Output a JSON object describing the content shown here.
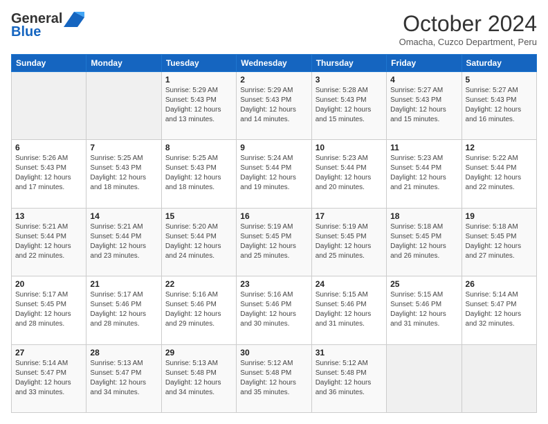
{
  "logo": {
    "line1": "General",
    "line2": "Blue"
  },
  "header": {
    "title": "October 2024",
    "subtitle": "Omacha, Cuzco Department, Peru"
  },
  "days_of_week": [
    "Sunday",
    "Monday",
    "Tuesday",
    "Wednesday",
    "Thursday",
    "Friday",
    "Saturday"
  ],
  "weeks": [
    [
      {
        "day": "",
        "sunrise": "",
        "sunset": "",
        "daylight": ""
      },
      {
        "day": "",
        "sunrise": "",
        "sunset": "",
        "daylight": ""
      },
      {
        "day": "1",
        "sunrise": "Sunrise: 5:29 AM",
        "sunset": "Sunset: 5:43 PM",
        "daylight": "Daylight: 12 hours and 13 minutes."
      },
      {
        "day": "2",
        "sunrise": "Sunrise: 5:29 AM",
        "sunset": "Sunset: 5:43 PM",
        "daylight": "Daylight: 12 hours and 14 minutes."
      },
      {
        "day": "3",
        "sunrise": "Sunrise: 5:28 AM",
        "sunset": "Sunset: 5:43 PM",
        "daylight": "Daylight: 12 hours and 15 minutes."
      },
      {
        "day": "4",
        "sunrise": "Sunrise: 5:27 AM",
        "sunset": "Sunset: 5:43 PM",
        "daylight": "Daylight: 12 hours and 15 minutes."
      },
      {
        "day": "5",
        "sunrise": "Sunrise: 5:27 AM",
        "sunset": "Sunset: 5:43 PM",
        "daylight": "Daylight: 12 hours and 16 minutes."
      }
    ],
    [
      {
        "day": "6",
        "sunrise": "Sunrise: 5:26 AM",
        "sunset": "Sunset: 5:43 PM",
        "daylight": "Daylight: 12 hours and 17 minutes."
      },
      {
        "day": "7",
        "sunrise": "Sunrise: 5:25 AM",
        "sunset": "Sunset: 5:43 PM",
        "daylight": "Daylight: 12 hours and 18 minutes."
      },
      {
        "day": "8",
        "sunrise": "Sunrise: 5:25 AM",
        "sunset": "Sunset: 5:43 PM",
        "daylight": "Daylight: 12 hours and 18 minutes."
      },
      {
        "day": "9",
        "sunrise": "Sunrise: 5:24 AM",
        "sunset": "Sunset: 5:44 PM",
        "daylight": "Daylight: 12 hours and 19 minutes."
      },
      {
        "day": "10",
        "sunrise": "Sunrise: 5:23 AM",
        "sunset": "Sunset: 5:44 PM",
        "daylight": "Daylight: 12 hours and 20 minutes."
      },
      {
        "day": "11",
        "sunrise": "Sunrise: 5:23 AM",
        "sunset": "Sunset: 5:44 PM",
        "daylight": "Daylight: 12 hours and 21 minutes."
      },
      {
        "day": "12",
        "sunrise": "Sunrise: 5:22 AM",
        "sunset": "Sunset: 5:44 PM",
        "daylight": "Daylight: 12 hours and 22 minutes."
      }
    ],
    [
      {
        "day": "13",
        "sunrise": "Sunrise: 5:21 AM",
        "sunset": "Sunset: 5:44 PM",
        "daylight": "Daylight: 12 hours and 22 minutes."
      },
      {
        "day": "14",
        "sunrise": "Sunrise: 5:21 AM",
        "sunset": "Sunset: 5:44 PM",
        "daylight": "Daylight: 12 hours and 23 minutes."
      },
      {
        "day": "15",
        "sunrise": "Sunrise: 5:20 AM",
        "sunset": "Sunset: 5:44 PM",
        "daylight": "Daylight: 12 hours and 24 minutes."
      },
      {
        "day": "16",
        "sunrise": "Sunrise: 5:19 AM",
        "sunset": "Sunset: 5:45 PM",
        "daylight": "Daylight: 12 hours and 25 minutes."
      },
      {
        "day": "17",
        "sunrise": "Sunrise: 5:19 AM",
        "sunset": "Sunset: 5:45 PM",
        "daylight": "Daylight: 12 hours and 25 minutes."
      },
      {
        "day": "18",
        "sunrise": "Sunrise: 5:18 AM",
        "sunset": "Sunset: 5:45 PM",
        "daylight": "Daylight: 12 hours and 26 minutes."
      },
      {
        "day": "19",
        "sunrise": "Sunrise: 5:18 AM",
        "sunset": "Sunset: 5:45 PM",
        "daylight": "Daylight: 12 hours and 27 minutes."
      }
    ],
    [
      {
        "day": "20",
        "sunrise": "Sunrise: 5:17 AM",
        "sunset": "Sunset: 5:45 PM",
        "daylight": "Daylight: 12 hours and 28 minutes."
      },
      {
        "day": "21",
        "sunrise": "Sunrise: 5:17 AM",
        "sunset": "Sunset: 5:46 PM",
        "daylight": "Daylight: 12 hours and 28 minutes."
      },
      {
        "day": "22",
        "sunrise": "Sunrise: 5:16 AM",
        "sunset": "Sunset: 5:46 PM",
        "daylight": "Daylight: 12 hours and 29 minutes."
      },
      {
        "day": "23",
        "sunrise": "Sunrise: 5:16 AM",
        "sunset": "Sunset: 5:46 PM",
        "daylight": "Daylight: 12 hours and 30 minutes."
      },
      {
        "day": "24",
        "sunrise": "Sunrise: 5:15 AM",
        "sunset": "Sunset: 5:46 PM",
        "daylight": "Daylight: 12 hours and 31 minutes."
      },
      {
        "day": "25",
        "sunrise": "Sunrise: 5:15 AM",
        "sunset": "Sunset: 5:46 PM",
        "daylight": "Daylight: 12 hours and 31 minutes."
      },
      {
        "day": "26",
        "sunrise": "Sunrise: 5:14 AM",
        "sunset": "Sunset: 5:47 PM",
        "daylight": "Daylight: 12 hours and 32 minutes."
      }
    ],
    [
      {
        "day": "27",
        "sunrise": "Sunrise: 5:14 AM",
        "sunset": "Sunset: 5:47 PM",
        "daylight": "Daylight: 12 hours and 33 minutes."
      },
      {
        "day": "28",
        "sunrise": "Sunrise: 5:13 AM",
        "sunset": "Sunset: 5:47 PM",
        "daylight": "Daylight: 12 hours and 34 minutes."
      },
      {
        "day": "29",
        "sunrise": "Sunrise: 5:13 AM",
        "sunset": "Sunset: 5:48 PM",
        "daylight": "Daylight: 12 hours and 34 minutes."
      },
      {
        "day": "30",
        "sunrise": "Sunrise: 5:12 AM",
        "sunset": "Sunset: 5:48 PM",
        "daylight": "Daylight: 12 hours and 35 minutes."
      },
      {
        "day": "31",
        "sunrise": "Sunrise: 5:12 AM",
        "sunset": "Sunset: 5:48 PM",
        "daylight": "Daylight: 12 hours and 36 minutes."
      },
      {
        "day": "",
        "sunrise": "",
        "sunset": "",
        "daylight": ""
      },
      {
        "day": "",
        "sunrise": "",
        "sunset": "",
        "daylight": ""
      }
    ]
  ]
}
